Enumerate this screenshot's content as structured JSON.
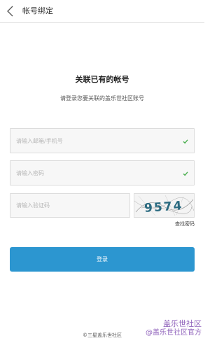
{
  "header": {
    "title": "帐号绑定"
  },
  "main": {
    "title": "关联已有的帐号",
    "subtitle": "请登录您要关联的盖乐世社区账号"
  },
  "form": {
    "email_placeholder": "请输入邮箱/手机号",
    "password_placeholder": "请输入密码",
    "captcha_placeholder": "请输入验证码",
    "captcha_text": "9574",
    "forgot_password": "查找密码",
    "login_button": "登录"
  },
  "footer": {
    "copyright": "©三星盖乐世社区"
  },
  "watermark": {
    "line1": "盖乐世社区",
    "line2": "@盖乐世社区官方"
  },
  "colors": {
    "primary": "#2c96d0",
    "check": "#4caf50",
    "field_bg": "#f7f7f7",
    "border": "#dcdcdc",
    "watermark": "#8a5ab8"
  },
  "icons": {
    "back": "chevron-left-icon",
    "valid": "check-icon"
  }
}
